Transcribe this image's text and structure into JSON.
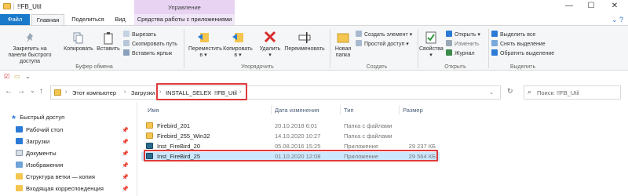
{
  "window": {
    "title": "!!FB_Util",
    "manage_label": "Управление",
    "minimize": "—",
    "maximize": "☐",
    "close": "✕"
  },
  "tabs": {
    "file": "Файл",
    "home": "Главная",
    "share": "Поделиться",
    "view": "Вид",
    "app_tools": "Средства работы с приложениями",
    "right_glyph": "⌄ ?"
  },
  "ribbon": {
    "pin_label": "Закрепить на панели быстрого доступа",
    "copy_label": "Копировать",
    "paste_label": "Вставить",
    "cut_label": "Вырезать",
    "copy_path_label": "Скопировать путь",
    "paste_shortcut_label": "Вставить ярлык",
    "clipboard_group": "Буфер обмена",
    "move_to_label": "Переместить в ▾",
    "copy_to_label": "Копировать в ▾",
    "delete_label": "Удалить ▾",
    "rename_label": "Переименовать",
    "organize_group": "Упорядочить",
    "new_folder_label": "Новая папка",
    "new_item_label": "Создать элемент ▾",
    "easy_access_label": "Простой доступ ▾",
    "create_group": "Создать",
    "properties_label": "Свойства ▾",
    "open_label": "Открыть ▾",
    "edit_label": "Изменить",
    "history_label": "Журнал",
    "open_group": "Открыть",
    "select_all_label": "Выделить все",
    "select_none_label": "Снять выделение",
    "invert_selection_label": "Обратить выделение",
    "select_group": "Выделить"
  },
  "address": {
    "crumb_pc": "Этот компьютер",
    "crumb_downloads": "Загрузки",
    "crumb_install": "INSTALL_SELEX",
    "crumb_fbutil": "!!FB_Util",
    "search_placeholder": "Поиск: !!FB_Util"
  },
  "nav": {
    "quick_access": "Быстрый доступ",
    "items": [
      {
        "label": "Рабочий стол",
        "icon": "desktop-icon"
      },
      {
        "label": "Загрузки",
        "icon": "downloads-icon"
      },
      {
        "label": "Документы",
        "icon": "documents-icon"
      },
      {
        "label": "Изображения",
        "icon": "pictures-icon"
      },
      {
        "label": "Структура ветки — копия",
        "icon": "folder-icon"
      },
      {
        "label": "Входящая корреспонденция",
        "icon": "folder-icon"
      }
    ]
  },
  "columns": {
    "name": "Имя",
    "date": "Дата изменения",
    "type": "Тип",
    "size": "Размер"
  },
  "files": [
    {
      "name": "Firebird_201",
      "date": "20.10.2018 6:01",
      "type": "Папка с файлами",
      "size": "",
      "icon": "folder-icon"
    },
    {
      "name": "Firebird_255_Win32",
      "date": "14.10.2020 10:27",
      "type": "Папка с файлами",
      "size": "",
      "icon": "folder-icon"
    },
    {
      "name": "Inst_FireBird_20",
      "date": "05.08.2016 15:25",
      "type": "Приложение",
      "size": "29 237 КБ",
      "icon": "app-icon"
    },
    {
      "name": "Inst_FireBird_25",
      "date": "01.10.2020 12:08",
      "type": "Приложение",
      "size": "29 564 КБ",
      "icon": "app-icon"
    }
  ]
}
